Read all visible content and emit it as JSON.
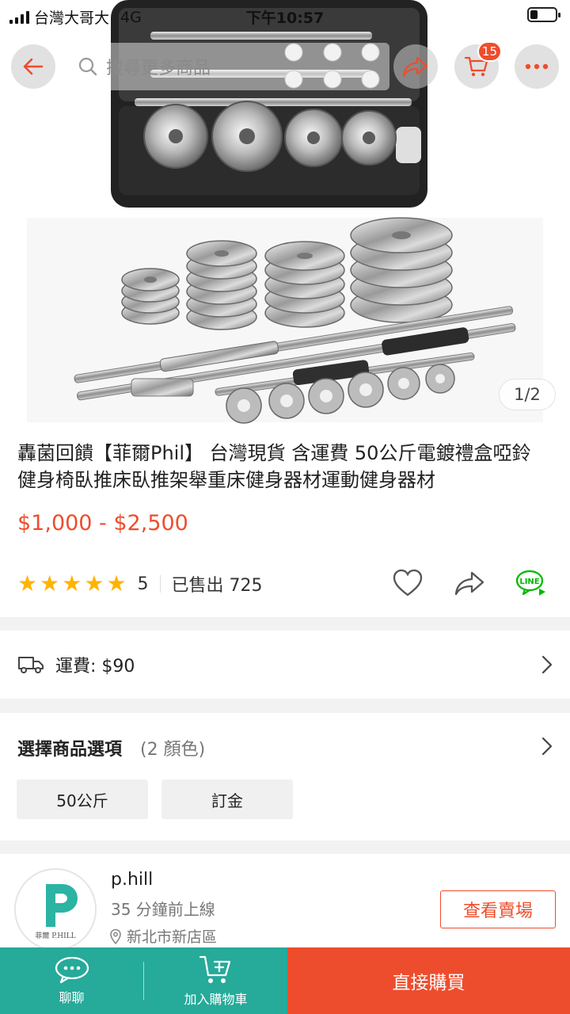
{
  "status_bar": {
    "carrier": "台灣大哥大",
    "network": "4G",
    "time": "下午10:57"
  },
  "nav": {
    "back_icon": "arrow-left-icon",
    "search_placeholder": "搜尋更多商品",
    "share_icon": "share-icon",
    "cart_icon": "cart-icon",
    "cart_badge": "15",
    "more_icon": "more-icon"
  },
  "gallery": {
    "counter": "1/2"
  },
  "product": {
    "title": "轟菌回饋【菲爾Phil】 台灣現貨 含運費 50公斤電鍍禮盒啞鈴 健身椅臥推床臥推架舉重床健身器材運動健身器材",
    "price": "$1,000 - $2,500",
    "rating_value": "5",
    "stars": 5,
    "sold": "已售出 725",
    "price_color": "#ee4d2d"
  },
  "shipping": {
    "label": "運費: $90"
  },
  "variations": {
    "title": "選擇商品選項",
    "count": "(2 顏色)",
    "options": [
      "50公斤",
      "訂金"
    ]
  },
  "shop": {
    "name": "p.hill",
    "online": "35 分鐘前上線",
    "location": "新北市新店區",
    "button": "查看賣場",
    "logo_text": "菲爾 P.HILL"
  },
  "bottom_bar": {
    "chat": "聊聊",
    "add_to_cart": "加入購物車",
    "buy_now": "直接購買",
    "accent": "#26aa99",
    "brand": "#ee4d2d"
  }
}
